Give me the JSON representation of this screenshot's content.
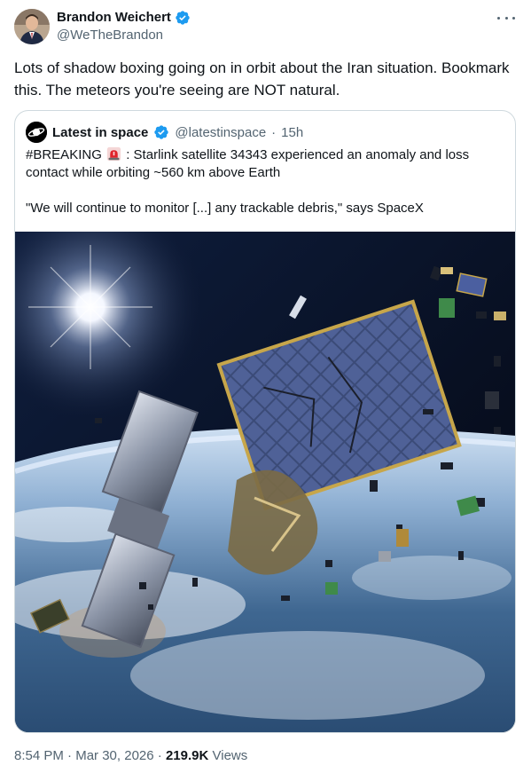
{
  "author": {
    "display_name": "Brandon Weichert",
    "handle": "@WeTheBrandon",
    "verified": true,
    "verified_color": "#1d9bf0",
    "avatar_icon": "avatar-photo"
  },
  "tweet": {
    "text": "Lots of shadow boxing going on in orbit about the Iran situation. Bookmark this. The meteors you're seeing are NOT natural."
  },
  "quote": {
    "display_name": "Latest in space",
    "handle": "@latestinspace",
    "separator": "·",
    "time": "15h",
    "verified_color": "#1d9bf0",
    "line1_prefix": "#BREAKING",
    "line1_emoji": "rotating-light-icon",
    "line1_suffix": ": Starlink satellite 34343 experienced an anomaly and loss contact while orbiting ~560 km above Earth",
    "line2": "\"We will continue to monitor [...] any trackable debris,\" says SpaceX",
    "media_icon": "satellite-debris-image"
  },
  "footer": {
    "time": "8:54 PM",
    "sep1": "·",
    "date": "Mar 30, 2026",
    "sep2": "·",
    "views_count": "219.9K",
    "views_label": "Views"
  }
}
